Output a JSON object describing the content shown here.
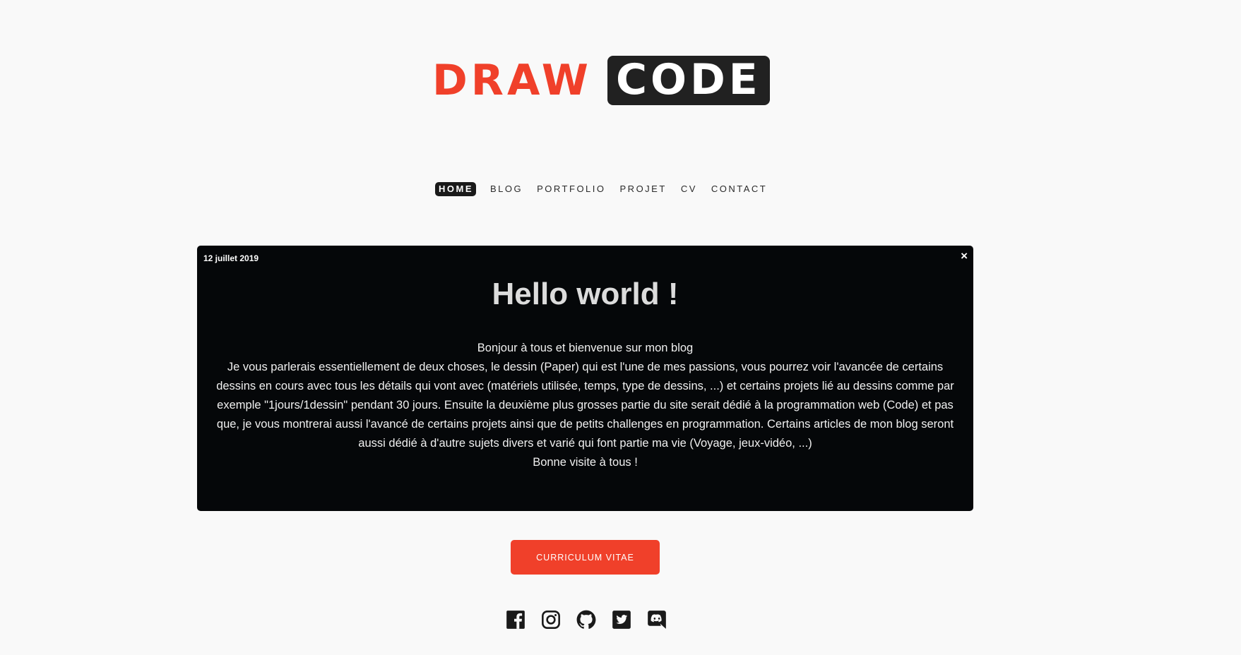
{
  "logo": {
    "draw": "DRAW",
    "code": "CODE"
  },
  "nav": {
    "items": [
      {
        "label": "HOME"
      },
      {
        "label": "BLOG"
      },
      {
        "label": "PORTFOLIO"
      },
      {
        "label": "PROJET"
      },
      {
        "label": "CV"
      },
      {
        "label": "CONTACT"
      }
    ]
  },
  "post": {
    "date": "12 juillet 2019",
    "close": "×",
    "title": "Hello world !",
    "intro": "Bonjour à tous et bienvenue sur mon blog",
    "body": "Je vous parlerais essentiellement de deux choses, le dessin (Paper) qui est l'une de mes passions, vous pourrez voir l'avancée de certains dessins en cours avec tous les détails qui vont avec (matériels utilisée, temps, type de dessins, ...) et certains projets lié au dessins comme par exemple \"1jours/1dessin\" pendant 30 jours. Ensuite la deuxième plus grosses partie du site serait dédié à la programmation web (Code) et pas que, je vous montrerai aussi l'avancé de certains projets ainsi que de petits challenges en programmation. Certains articles de mon blog seront aussi dédié à d'autre sujets divers et varié qui font partie ma vie (Voyage, jeux-vidéo, ...)",
    "outro": "Bonne visite à tous !"
  },
  "cv_button": {
    "label": "CURRICULUM VITAE"
  },
  "socials": [
    "facebook-icon",
    "instagram-icon",
    "github-icon",
    "twitter-icon",
    "discord-icon"
  ],
  "colors": {
    "accent": "#f0402a",
    "dark": "#212121",
    "card_bg": "#050709",
    "page_bg": "#f9f9f9"
  }
}
